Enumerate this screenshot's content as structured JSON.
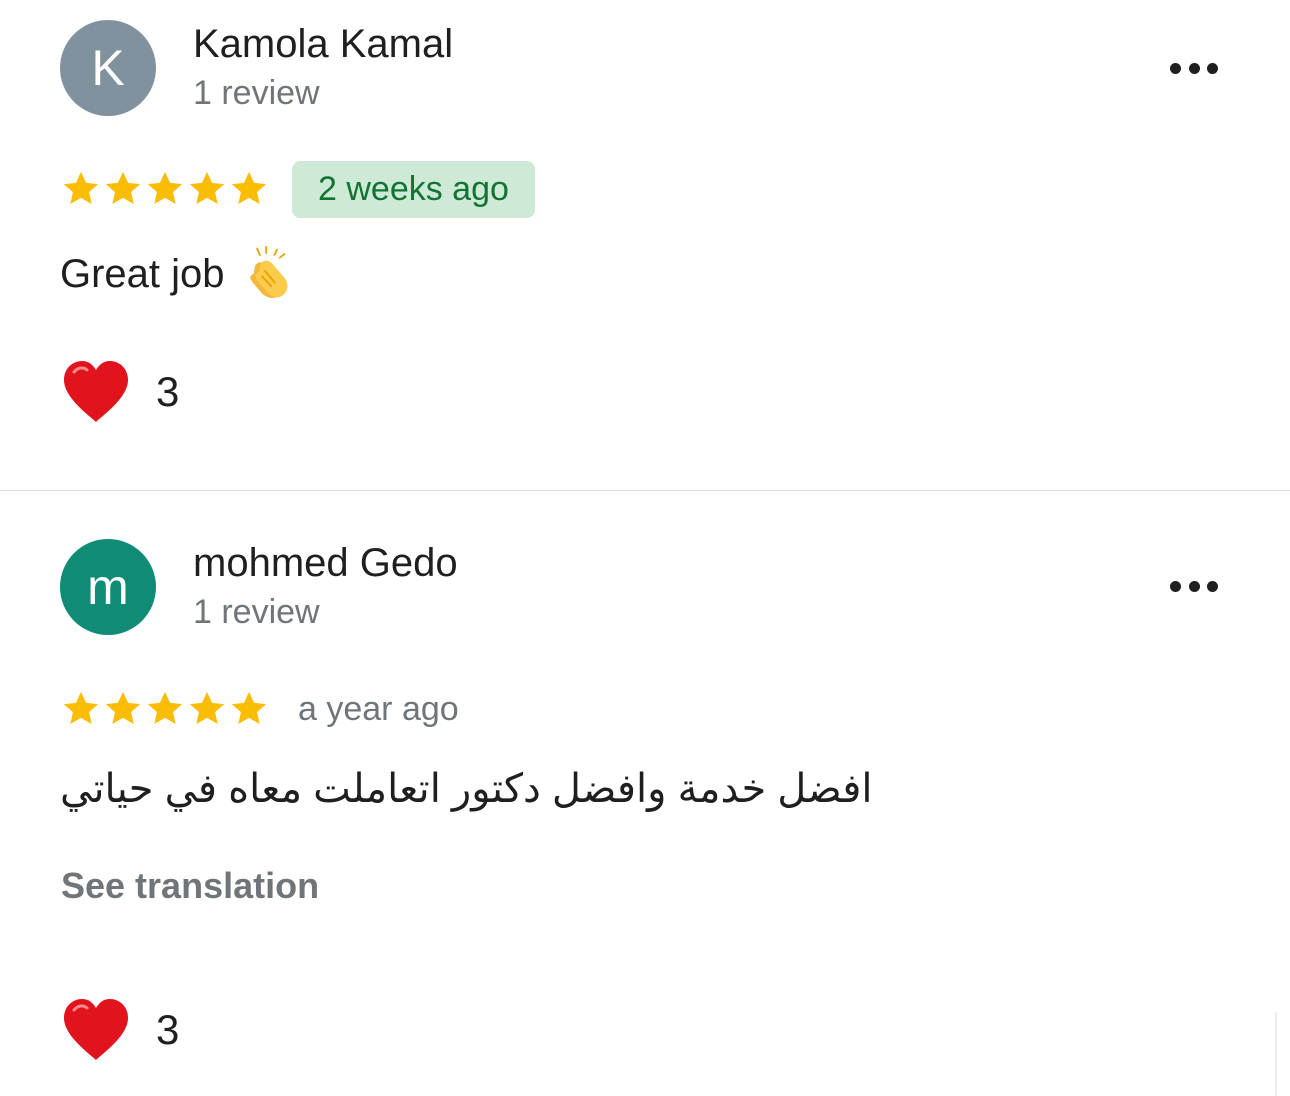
{
  "reviews": [
    {
      "author": "Kamola Kamal",
      "avatar_letter": "K",
      "avatar_color": "#7f929e",
      "review_count": "1 review",
      "rating": 5,
      "time": "2 weeks ago",
      "time_highlighted": true,
      "text": "Great job",
      "text_emoji": "clapping-hands-icon",
      "see_translation": "",
      "reaction_icon": "red-heart-icon",
      "reaction_count": "3"
    },
    {
      "author": "mohmed Gedo",
      "avatar_letter": "m",
      "avatar_color": "#0f8b76",
      "review_count": "1 review",
      "rating": 5,
      "time": "a year ago",
      "time_highlighted": false,
      "text": "افضل خدمة وافضل دكتور اتعاملت معاه في حياتي",
      "see_translation": "See translation",
      "reaction_icon": "red-heart-icon",
      "reaction_count": "3"
    }
  ],
  "colors": {
    "star": "#fbbc04",
    "badge_bg": "#ceead6",
    "badge_text": "#137333",
    "secondary_text": "#70757a",
    "heart": "#e1141e"
  }
}
